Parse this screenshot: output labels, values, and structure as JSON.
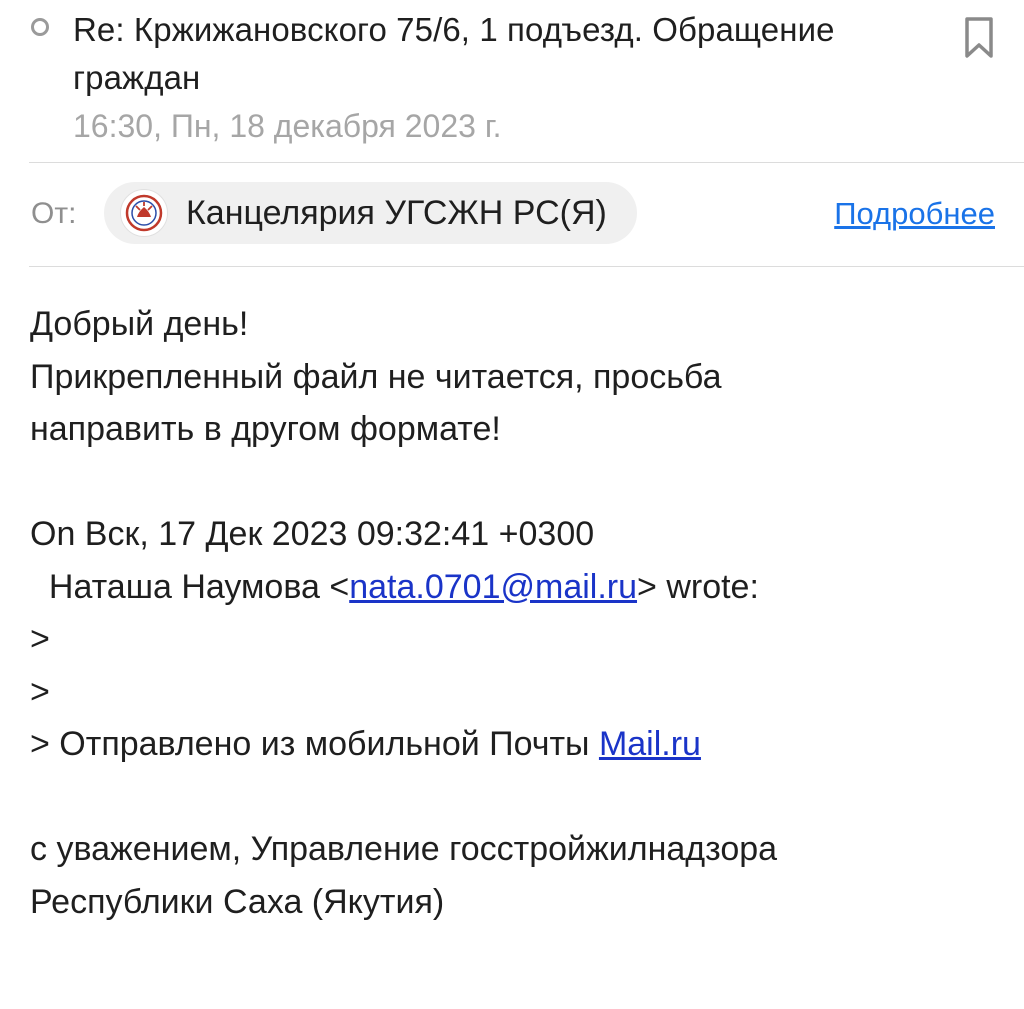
{
  "header": {
    "subject": "Re: Кржижановского 75/6, 1 подъезд. Обращение граждан",
    "date": "16:30, Пн, 18 декабря 2023 г."
  },
  "from": {
    "label": "От:",
    "sender_name": "Канцелярия УГСЖН РС(Я)",
    "details_link": "Подробнее"
  },
  "body": {
    "greeting": "Добрый день!",
    "line1": "Прикрепленный файл не читается, просьба",
    "line2": "направить в другом формате!",
    "quote_header_line1": "On Вск, 17 Дек 2023 09:32:41 +0300",
    "quote_header_prefix": "  Наташа Наумова <",
    "quote_email": "nata.0701@mail.ru",
    "quote_header_suffix": "> wrote:",
    "quote_marker_1": ">",
    "quote_marker_2": ">",
    "quote_footer_prefix": "> Отправлено из мобильной Почты ",
    "quote_footer_link": "Mail.ru",
    "signature_line1": "с уважением, Управление госстройжилнадзора",
    "signature_line2": "Республики Саха (Якутия)"
  },
  "colors": {
    "link": "#1a34c8",
    "details_link": "#1a73e8",
    "muted": "#a6a6a6"
  },
  "icons": {
    "unread": "unread-dot-icon",
    "bookmark": "bookmark-icon",
    "avatar": "sender-emblem-icon"
  }
}
